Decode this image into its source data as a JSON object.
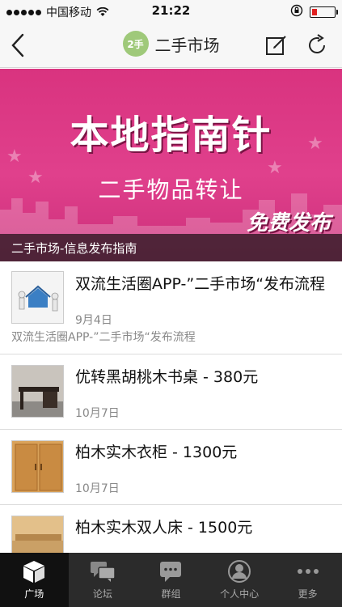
{
  "status_bar": {
    "carrier": "中国移动",
    "time": "21:22"
  },
  "nav": {
    "logo_text": "2手",
    "title": "二手市场"
  },
  "banner": {
    "title": "本地指南针",
    "subtitle": "二手物品转让",
    "badge": "免费发布",
    "caption": "二手市场-信息发布指南"
  },
  "list": [
    {
      "title": "双流生活圈APP-”二手市场“发布流程",
      "date": "9月4日",
      "desc": "双流生活圈APP-”二手市场“发布流程"
    },
    {
      "title": "优转黑胡桃木书桌 - 380元",
      "date": "10月7日"
    },
    {
      "title": "柏木实木衣柜 - 1300元",
      "date": "10月7日"
    },
    {
      "title": "柏木实木双人床 - 1500元"
    }
  ],
  "tabs": [
    {
      "label": "广场",
      "icon": "cube-icon",
      "active": true
    },
    {
      "label": "论坛",
      "icon": "chat-bubbles-icon"
    },
    {
      "label": "群组",
      "icon": "group-chat-icon"
    },
    {
      "label": "个人中心",
      "icon": "person-icon"
    },
    {
      "label": "更多",
      "icon": "more-dots-icon"
    }
  ],
  "colors": {
    "banner": "#d9337f",
    "logo": "#9fc97a",
    "tabbar": "#2b2b2b",
    "battery_low": "#e02020"
  }
}
